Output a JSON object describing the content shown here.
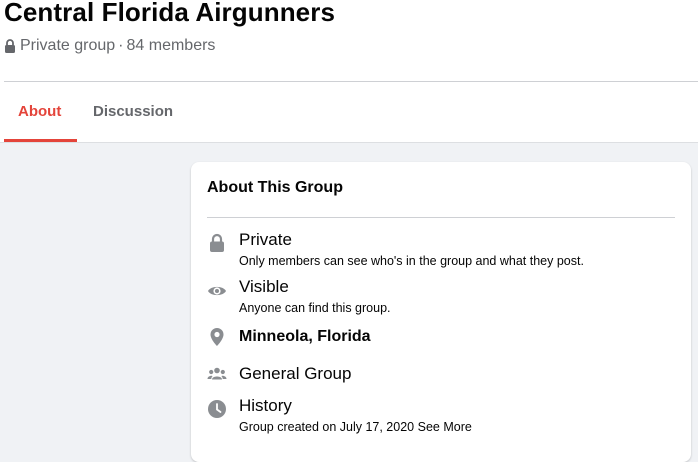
{
  "group": {
    "name": "Central Florida Airgunners",
    "privacy": "Private group",
    "separator": "·",
    "members": "84 members"
  },
  "tabs": [
    {
      "label": "About"
    },
    {
      "label": "Discussion"
    }
  ],
  "about": {
    "title": "About This Group",
    "items": [
      {
        "icon": "lock-icon",
        "title": "Private",
        "description": "Only members can see who's in the group and what they post."
      },
      {
        "icon": "eye-icon",
        "title": "Visible",
        "description": "Anyone can find this group."
      },
      {
        "icon": "location-pin-icon",
        "title": "Minneola, Florida"
      },
      {
        "icon": "people-icon",
        "title": "General Group"
      },
      {
        "icon": "clock-icon",
        "title": "History",
        "description": "Group created on July 17, 2020",
        "link": "See More"
      }
    ]
  },
  "colors": {
    "accent": "#e4443a",
    "icon": "#65676b",
    "background": "#f0f2f5"
  }
}
